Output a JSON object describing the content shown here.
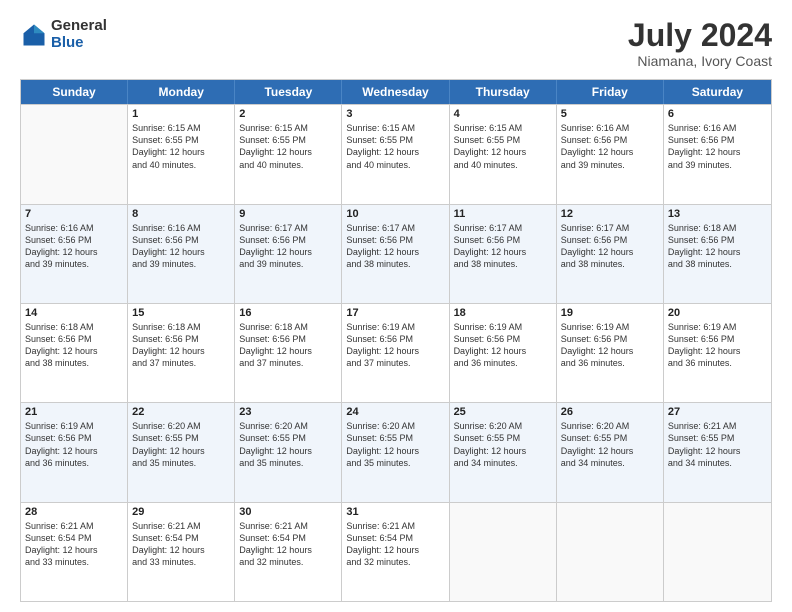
{
  "logo": {
    "general": "General",
    "blue": "Blue"
  },
  "title": "July 2024",
  "subtitle": "Niamana, Ivory Coast",
  "days": [
    "Sunday",
    "Monday",
    "Tuesday",
    "Wednesday",
    "Thursday",
    "Friday",
    "Saturday"
  ],
  "weeks": [
    [
      {
        "num": "",
        "info": ""
      },
      {
        "num": "1",
        "info": "Sunrise: 6:15 AM\nSunset: 6:55 PM\nDaylight: 12 hours\nand 40 minutes."
      },
      {
        "num": "2",
        "info": "Sunrise: 6:15 AM\nSunset: 6:55 PM\nDaylight: 12 hours\nand 40 minutes."
      },
      {
        "num": "3",
        "info": "Sunrise: 6:15 AM\nSunset: 6:55 PM\nDaylight: 12 hours\nand 40 minutes."
      },
      {
        "num": "4",
        "info": "Sunrise: 6:15 AM\nSunset: 6:55 PM\nDaylight: 12 hours\nand 40 minutes."
      },
      {
        "num": "5",
        "info": "Sunrise: 6:16 AM\nSunset: 6:56 PM\nDaylight: 12 hours\nand 39 minutes."
      },
      {
        "num": "6",
        "info": "Sunrise: 6:16 AM\nSunset: 6:56 PM\nDaylight: 12 hours\nand 39 minutes."
      }
    ],
    [
      {
        "num": "7",
        "info": "Sunrise: 6:16 AM\nSunset: 6:56 PM\nDaylight: 12 hours\nand 39 minutes."
      },
      {
        "num": "8",
        "info": "Sunrise: 6:16 AM\nSunset: 6:56 PM\nDaylight: 12 hours\nand 39 minutes."
      },
      {
        "num": "9",
        "info": "Sunrise: 6:17 AM\nSunset: 6:56 PM\nDaylight: 12 hours\nand 39 minutes."
      },
      {
        "num": "10",
        "info": "Sunrise: 6:17 AM\nSunset: 6:56 PM\nDaylight: 12 hours\nand 38 minutes."
      },
      {
        "num": "11",
        "info": "Sunrise: 6:17 AM\nSunset: 6:56 PM\nDaylight: 12 hours\nand 38 minutes."
      },
      {
        "num": "12",
        "info": "Sunrise: 6:17 AM\nSunset: 6:56 PM\nDaylight: 12 hours\nand 38 minutes."
      },
      {
        "num": "13",
        "info": "Sunrise: 6:18 AM\nSunset: 6:56 PM\nDaylight: 12 hours\nand 38 minutes."
      }
    ],
    [
      {
        "num": "14",
        "info": "Sunrise: 6:18 AM\nSunset: 6:56 PM\nDaylight: 12 hours\nand 38 minutes."
      },
      {
        "num": "15",
        "info": "Sunrise: 6:18 AM\nSunset: 6:56 PM\nDaylight: 12 hours\nand 37 minutes."
      },
      {
        "num": "16",
        "info": "Sunrise: 6:18 AM\nSunset: 6:56 PM\nDaylight: 12 hours\nand 37 minutes."
      },
      {
        "num": "17",
        "info": "Sunrise: 6:19 AM\nSunset: 6:56 PM\nDaylight: 12 hours\nand 37 minutes."
      },
      {
        "num": "18",
        "info": "Sunrise: 6:19 AM\nSunset: 6:56 PM\nDaylight: 12 hours\nand 36 minutes."
      },
      {
        "num": "19",
        "info": "Sunrise: 6:19 AM\nSunset: 6:56 PM\nDaylight: 12 hours\nand 36 minutes."
      },
      {
        "num": "20",
        "info": "Sunrise: 6:19 AM\nSunset: 6:56 PM\nDaylight: 12 hours\nand 36 minutes."
      }
    ],
    [
      {
        "num": "21",
        "info": "Sunrise: 6:19 AM\nSunset: 6:56 PM\nDaylight: 12 hours\nand 36 minutes."
      },
      {
        "num": "22",
        "info": "Sunrise: 6:20 AM\nSunset: 6:55 PM\nDaylight: 12 hours\nand 35 minutes."
      },
      {
        "num": "23",
        "info": "Sunrise: 6:20 AM\nSunset: 6:55 PM\nDaylight: 12 hours\nand 35 minutes."
      },
      {
        "num": "24",
        "info": "Sunrise: 6:20 AM\nSunset: 6:55 PM\nDaylight: 12 hours\nand 35 minutes."
      },
      {
        "num": "25",
        "info": "Sunrise: 6:20 AM\nSunset: 6:55 PM\nDaylight: 12 hours\nand 34 minutes."
      },
      {
        "num": "26",
        "info": "Sunrise: 6:20 AM\nSunset: 6:55 PM\nDaylight: 12 hours\nand 34 minutes."
      },
      {
        "num": "27",
        "info": "Sunrise: 6:21 AM\nSunset: 6:55 PM\nDaylight: 12 hours\nand 34 minutes."
      }
    ],
    [
      {
        "num": "28",
        "info": "Sunrise: 6:21 AM\nSunset: 6:54 PM\nDaylight: 12 hours\nand 33 minutes."
      },
      {
        "num": "29",
        "info": "Sunrise: 6:21 AM\nSunset: 6:54 PM\nDaylight: 12 hours\nand 33 minutes."
      },
      {
        "num": "30",
        "info": "Sunrise: 6:21 AM\nSunset: 6:54 PM\nDaylight: 12 hours\nand 32 minutes."
      },
      {
        "num": "31",
        "info": "Sunrise: 6:21 AM\nSunset: 6:54 PM\nDaylight: 12 hours\nand 32 minutes."
      },
      {
        "num": "",
        "info": ""
      },
      {
        "num": "",
        "info": ""
      },
      {
        "num": "",
        "info": ""
      }
    ]
  ]
}
